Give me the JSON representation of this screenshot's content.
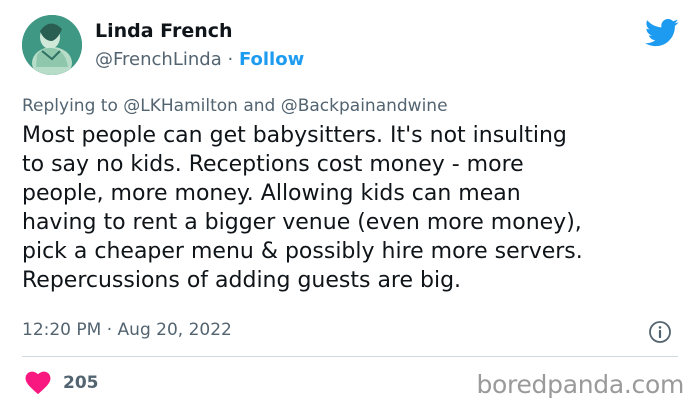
{
  "author": {
    "name": "Linda French",
    "handle": "@FrenchLinda",
    "separator": "·",
    "follow_label": "Follow"
  },
  "reply": {
    "prefix": "Replying to",
    "mention1": "@LKHamilton",
    "connector": "and",
    "mention2": "@Backpainandwine"
  },
  "tweet": {
    "text": "Most people can get babysitters. It's not insulting\nto say no kids. Receptions cost money - more\npeople, more money. Allowing kids can mean\nhaving to rent a bigger venue (even more money),\npick a cheaper menu & possibly hire more servers.\nRepercussions of adding guests are big.",
    "time": "12:20 PM",
    "separator": "·",
    "date": "Aug 20, 2022"
  },
  "engagement": {
    "likes": "205"
  },
  "watermark": "boredpanda.com",
  "icons": {
    "brand": "twitter-bird-icon",
    "info": "info-icon",
    "like": "heart-icon"
  },
  "colors": {
    "accent": "#1d9bf0",
    "heart": "#f91880",
    "text": "#0f1419",
    "muted": "#536471"
  }
}
